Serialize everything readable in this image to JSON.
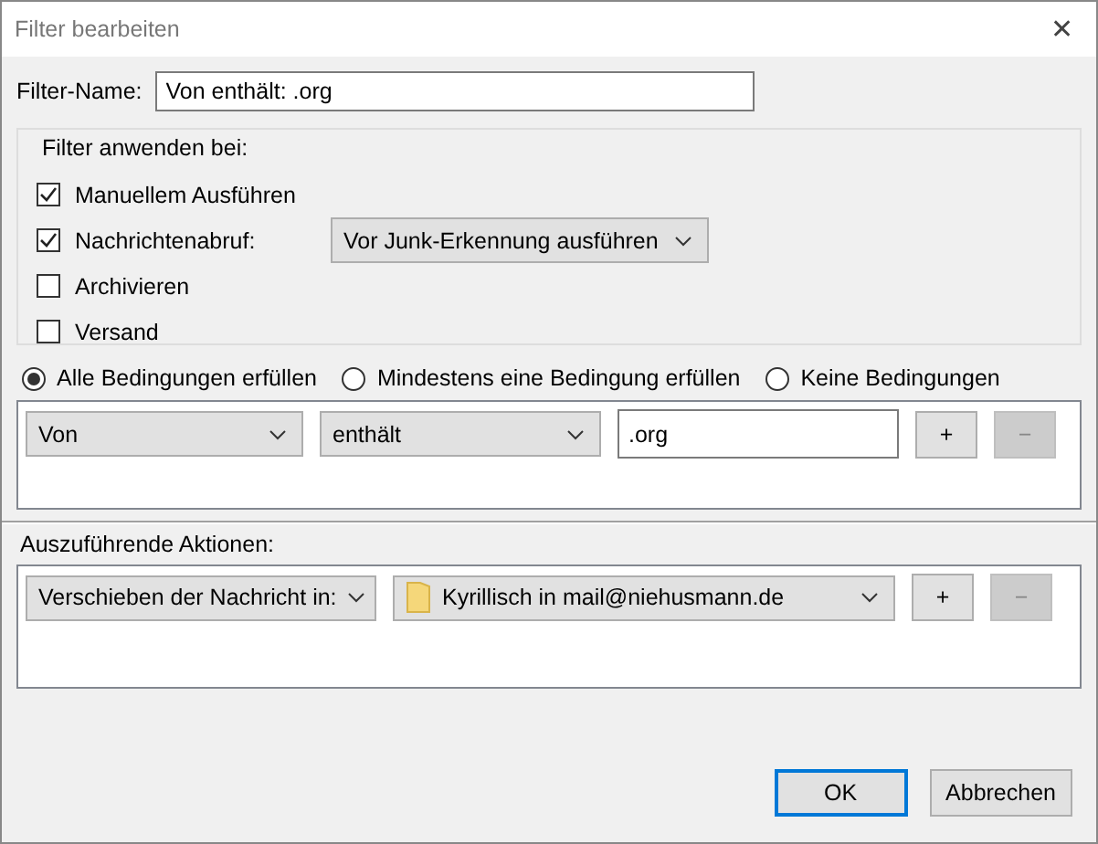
{
  "window": {
    "title": "Filter bearbeiten",
    "close": "✕"
  },
  "filter_name": {
    "label": "Filter-Name:",
    "value": "Von enthält: .org"
  },
  "apply_group": {
    "title": "Filter anwenden bei:",
    "items": [
      {
        "label": "Manuellem Ausführen",
        "checked": true
      },
      {
        "label": "Nachrichtenabruf:",
        "checked": true,
        "dropdown": "Vor Junk-Erkennung ausführen"
      },
      {
        "label": "Archivieren",
        "checked": false
      },
      {
        "label": "Versand",
        "checked": false
      }
    ]
  },
  "match_options": [
    {
      "label": "Alle Bedingungen erfüllen",
      "selected": true
    },
    {
      "label": "Mindestens eine Bedingung erfüllen",
      "selected": false
    },
    {
      "label": "Keine Bedingungen",
      "selected": false
    }
  ],
  "conditions": [
    {
      "field": "Von",
      "operator": "enthält",
      "value": ".org",
      "add": "+",
      "remove": "−",
      "remove_disabled": true
    }
  ],
  "actions_title": "Auszuführende Aktionen:",
  "actions": [
    {
      "action": "Verschieben der Nachricht in:",
      "target": "Kyrillisch in mail@niehusmann.de",
      "add": "+",
      "remove": "−",
      "remove_disabled": true
    }
  ],
  "buttons": [
    {
      "label": "OK",
      "default": true
    },
    {
      "label": "Abbrechen",
      "default": false
    }
  ]
}
